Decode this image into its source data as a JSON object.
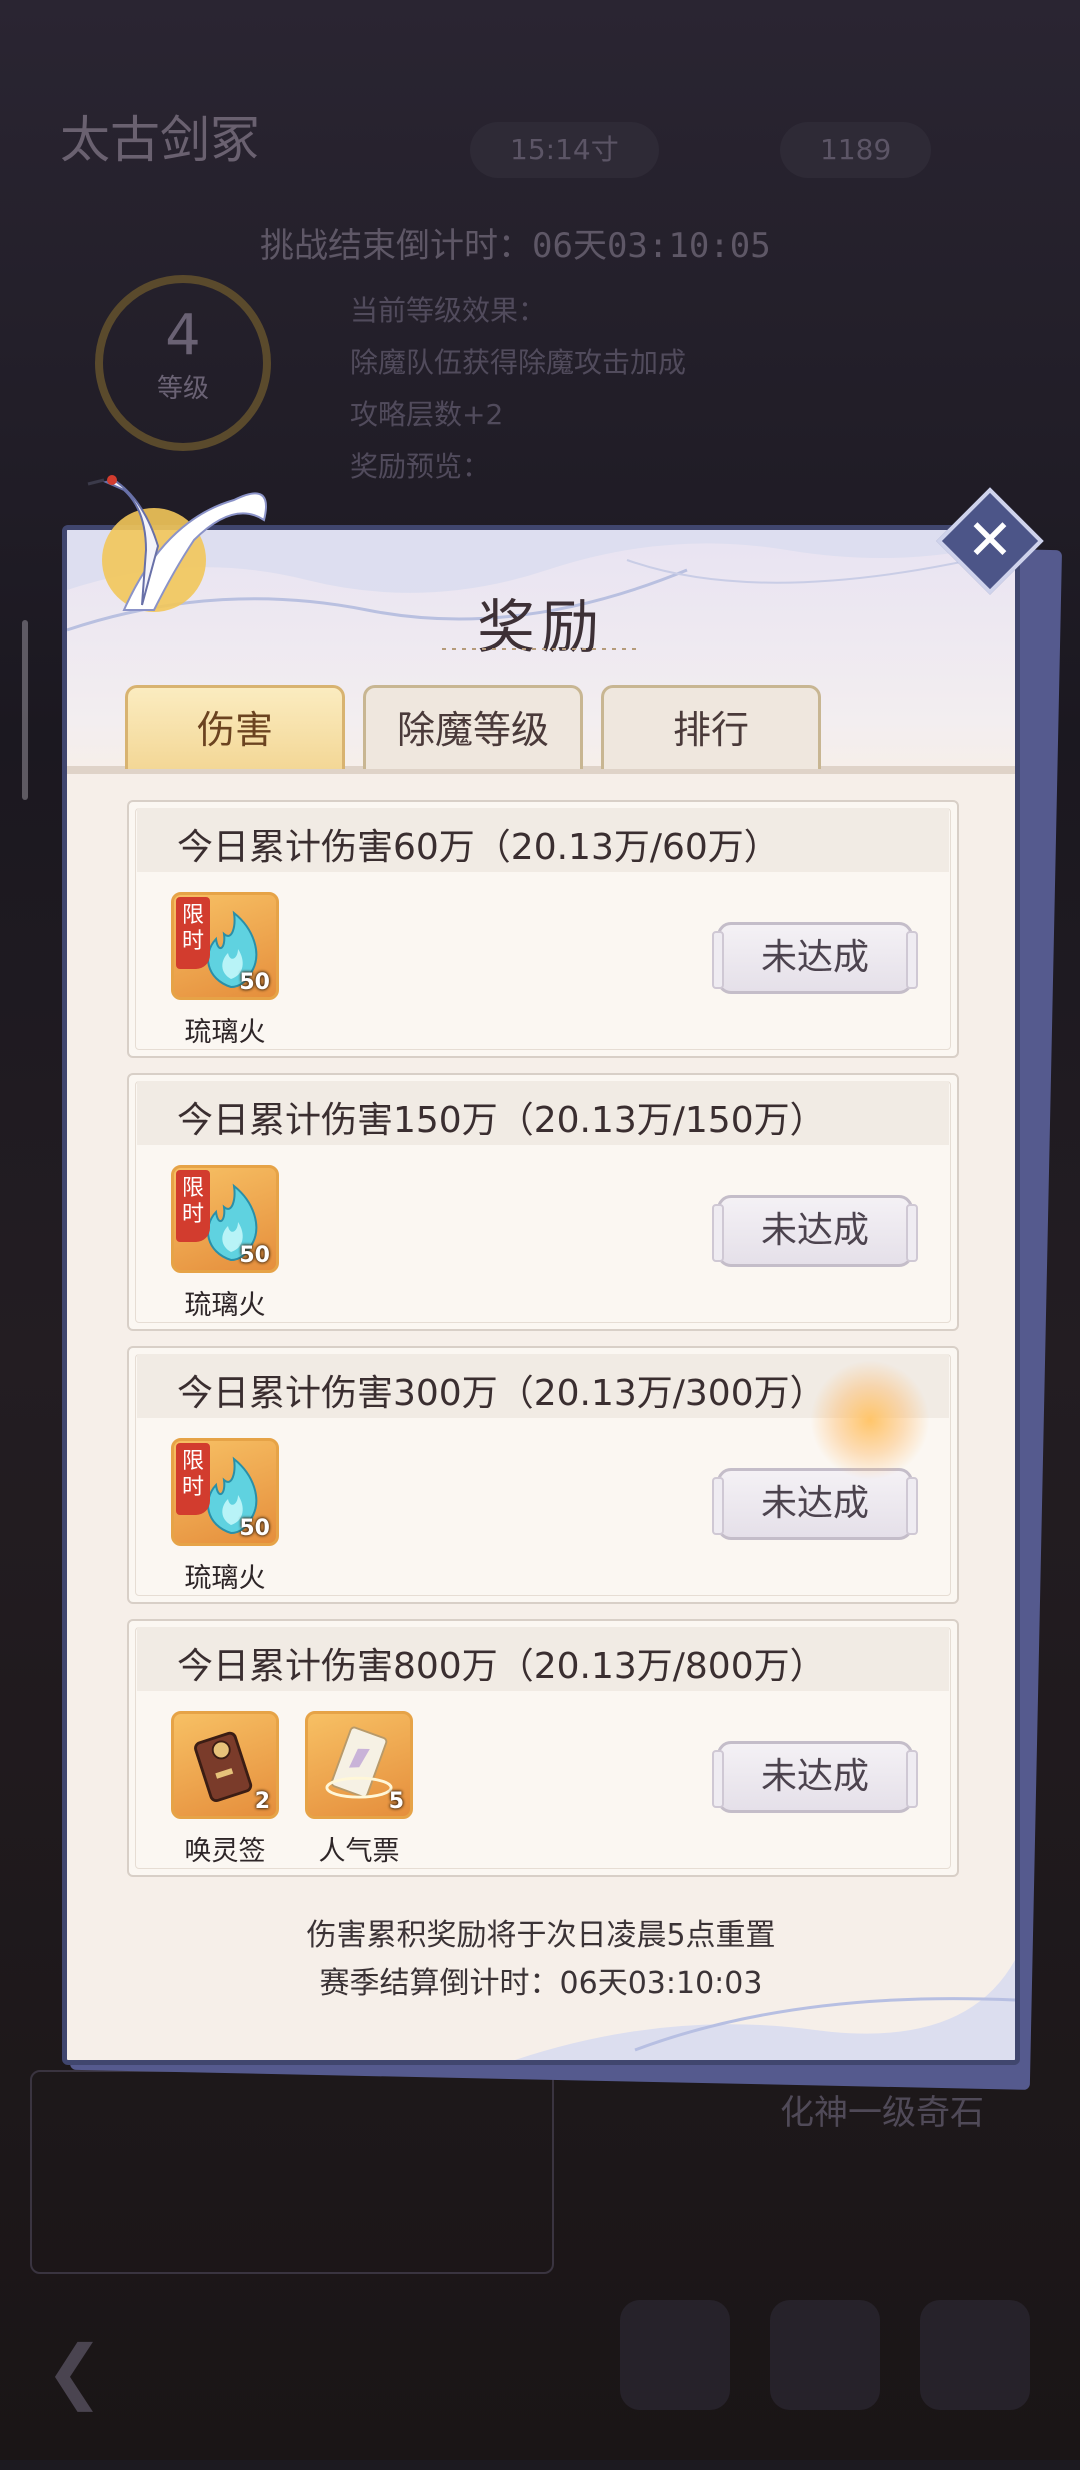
{
  "background": {
    "title": "太古剑冢",
    "pill_left": "15:14寸",
    "pill_right": "1189",
    "countdown": "挑战结束倒计时：06天03:10:05",
    "level_num": "4",
    "level_label": "等级",
    "lines": [
      "当前等级效果：",
      "除魔队伍获得除魔攻击加成",
      "攻略层数+2",
      "奖励预览："
    ],
    "side_text": "化神一级奇石"
  },
  "modal": {
    "title": "奖励",
    "tabs": [
      {
        "label": "伤害",
        "active": true
      },
      {
        "label": "除魔等级",
        "active": false
      },
      {
        "label": "排行",
        "active": false
      }
    ],
    "rewards": [
      {
        "title": "今日累计伤害60万（20.13万/60万）",
        "items": [
          {
            "name": "琉璃火",
            "qty": "50",
            "limited": true,
            "limit_label": "限时"
          }
        ],
        "status": "未达成"
      },
      {
        "title": "今日累计伤害150万（20.13万/150万）",
        "items": [
          {
            "name": "琉璃火",
            "qty": "50",
            "limited": true,
            "limit_label": "限时"
          }
        ],
        "status": "未达成"
      },
      {
        "title": "今日累计伤害300万（20.13万/300万）",
        "items": [
          {
            "name": "琉璃火",
            "qty": "50",
            "limited": true,
            "limit_label": "限时"
          }
        ],
        "status": "未达成"
      },
      {
        "title": "今日累计伤害800万（20.13万/800万）",
        "items": [
          {
            "name": "唤灵签",
            "qty": "2",
            "limited": false
          },
          {
            "name": "人气票",
            "qty": "5",
            "limited": false
          }
        ],
        "status": "未达成"
      }
    ],
    "footer_line1": "伤害累积奖励将于次日凌晨5点重置",
    "footer_line2": "赛季结算倒计时：06天03:10:03",
    "close_icon": "close-icon"
  },
  "colors": {
    "modal_border": "#40466e",
    "tab_active": "#f3d796",
    "item_frame": "#e6a347",
    "limit_badge": "#d23c2e"
  }
}
